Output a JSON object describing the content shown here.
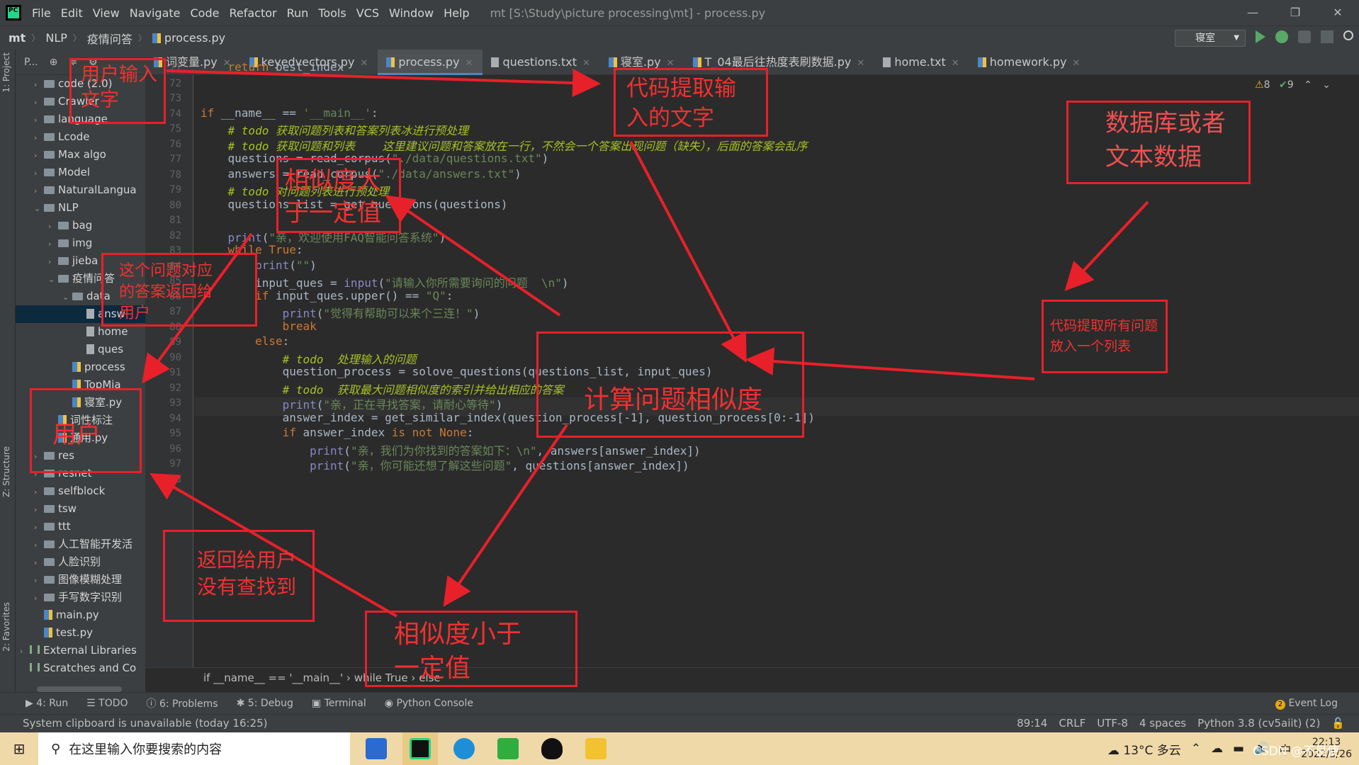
{
  "menubar": {
    "items": [
      "File",
      "Edit",
      "View",
      "Navigate",
      "Code",
      "Refactor",
      "Run",
      "Tools",
      "VCS",
      "Window",
      "Help"
    ],
    "window_title": "mt [S:\\Study\\picture processing\\mt] - process.py"
  },
  "navbar": {
    "crumbs": [
      "mt",
      "NLP",
      "疫情问答",
      "process.py"
    ],
    "run_config": "寝室"
  },
  "side_tabs": {
    "project": "1: Project",
    "structure": "Z: Structure",
    "favorites": "2: Favorites"
  },
  "project": {
    "header": "P...",
    "tree": [
      {
        "label": "code  (2.0)",
        "type": "folder",
        "depth": 1,
        "arrow": "›"
      },
      {
        "label": "Crawler",
        "type": "folder",
        "depth": 1,
        "arrow": "›"
      },
      {
        "label": "language",
        "type": "folder",
        "depth": 1,
        "arrow": "›"
      },
      {
        "label": "Lcode",
        "type": "folder",
        "depth": 1,
        "arrow": "›"
      },
      {
        "label": "Max algo",
        "type": "folder",
        "depth": 1,
        "arrow": "›"
      },
      {
        "label": "Model",
        "type": "folder",
        "depth": 1,
        "arrow": "›"
      },
      {
        "label": "NaturalLangua",
        "type": "folder",
        "depth": 1,
        "arrow": "›"
      },
      {
        "label": "NLP",
        "type": "folder",
        "depth": 1,
        "arrow": "⌄"
      },
      {
        "label": "bag",
        "type": "folder",
        "depth": 2,
        "arrow": "›"
      },
      {
        "label": "img",
        "type": "folder",
        "depth": 2,
        "arrow": "›"
      },
      {
        "label": "jieba",
        "type": "folder",
        "depth": 2,
        "arrow": "›"
      },
      {
        "label": "疫情问答",
        "type": "folder",
        "depth": 2,
        "arrow": "⌄"
      },
      {
        "label": "data",
        "type": "folder",
        "depth": 3,
        "arrow": "⌄"
      },
      {
        "label": "answ",
        "type": "txt",
        "depth": 4,
        "arrow": "",
        "selected": true
      },
      {
        "label": "home",
        "type": "txt",
        "depth": 4,
        "arrow": ""
      },
      {
        "label": "ques",
        "type": "txt",
        "depth": 4,
        "arrow": ""
      },
      {
        "label": "process",
        "type": "py",
        "depth": 3,
        "arrow": ""
      },
      {
        "label": "TopMia",
        "type": "py",
        "depth": 3,
        "arrow": ""
      },
      {
        "label": "寝室.py",
        "type": "py",
        "depth": 3,
        "arrow": ""
      },
      {
        "label": "词性标注",
        "type": "py",
        "depth": 2,
        "arrow": ""
      },
      {
        "label": "通用.py",
        "type": "py",
        "depth": 2,
        "arrow": ""
      },
      {
        "label": "res",
        "type": "folder",
        "depth": 1,
        "arrow": "›"
      },
      {
        "label": "resnet",
        "type": "folder",
        "depth": 1,
        "arrow": "›"
      },
      {
        "label": "selfblock",
        "type": "folder",
        "depth": 1,
        "arrow": "›"
      },
      {
        "label": "tsw",
        "type": "folder",
        "depth": 1,
        "arrow": "›"
      },
      {
        "label": "ttt",
        "type": "folder",
        "depth": 1,
        "arrow": "›"
      },
      {
        "label": "人工智能开发活",
        "type": "folder",
        "depth": 1,
        "arrow": "›"
      },
      {
        "label": "人脸识别",
        "type": "folder",
        "depth": 1,
        "arrow": "›"
      },
      {
        "label": "图像模糊处理",
        "type": "folder",
        "depth": 1,
        "arrow": "›"
      },
      {
        "label": "手写数字识别",
        "type": "folder",
        "depth": 1,
        "arrow": "›"
      },
      {
        "label": "main.py",
        "type": "py",
        "depth": 1,
        "arrow": ""
      },
      {
        "label": "test.py",
        "type": "py",
        "depth": 1,
        "arrow": ""
      },
      {
        "label": "External Libraries",
        "type": "lib",
        "depth": 0,
        "arrow": "›"
      },
      {
        "label": "Scratches and Co",
        "type": "lib",
        "depth": 0,
        "arrow": ""
      }
    ]
  },
  "tabs": [
    {
      "label": "词变量.py",
      "active": false
    },
    {
      "label": "keyedvectors.py",
      "active": false
    },
    {
      "label": "process.py",
      "active": true
    },
    {
      "label": "questions.txt",
      "active": false
    },
    {
      "label": "寝室.py",
      "active": false
    },
    {
      "label": "T_04最后往热度表刷数据.py",
      "active": false
    },
    {
      "label": "home.txt",
      "active": false
    },
    {
      "label": "homework.py",
      "active": false
    }
  ],
  "inspections": {
    "warnings": "8",
    "ok": "9"
  },
  "code": [
    {
      "n": "71",
      "html": "    <span class='kw'>return</span> best_index"
    },
    {
      "n": "72",
      "html": ""
    },
    {
      "n": "73",
      "html": ""
    },
    {
      "n": "74",
      "html": "<span class='kw'>if</span> __name__ == <span class='st'>'__main__'</span>:"
    },
    {
      "n": "75",
      "html": "    <span class='td'># todo 获取问题列表和答案列表冰进行预处理</span>"
    },
    {
      "n": "76",
      "html": "    <span class='td'># todo 获取问题和列表    这里建议问题和答案放在一行，不然会一个答案出现问题（缺失），后面的答案会乱序</span>"
    },
    {
      "n": "77",
      "html": "    questions = read_corpus(<span class='st'>\"./data/questions.txt\"</span>)"
    },
    {
      "n": "78",
      "html": "    answers = read_corpus(<span class='st'>\"./data/answers.txt\"</span>)"
    },
    {
      "n": "79",
      "html": "    <span class='td'># todo 对问题列表进行预处理</span>"
    },
    {
      "n": "80",
      "html": "    questions_list = get_questions(questions)"
    },
    {
      "n": "81",
      "html": ""
    },
    {
      "n": "82",
      "html": "    <span class='bi'>print</span>(<span class='st'>\"亲，欢迎使用FAQ智能问答系统\"</span>)"
    },
    {
      "n": "83",
      "html": "    <span class='kw'>while True</span>:"
    },
    {
      "n": "84",
      "html": "        <span class='bi'>print</span>(<span class='st'>\"\"</span>)"
    },
    {
      "n": "85",
      "html": "        input_ques = <span class='bi'>input</span>(<span class='st'>\"请输入你所需要询问的问题  \\n\"</span>)"
    },
    {
      "n": "86",
      "html": "        <span class='kw'>if</span> input_ques.upper() == <span class='st'>\"Q\"</span>:"
    },
    {
      "n": "87",
      "html": "            <span class='bi'>print</span>(<span class='st'>\"觉得有帮助可以来个三连！\"</span>)"
    },
    {
      "n": "88",
      "html": "            <span class='kw'>break</span>"
    },
    {
      "n": "89",
      "html": "        <span class='kw'>else</span>:"
    },
    {
      "n": "90",
      "html": "            <span class='td'># todo  处理输入的问题</span>"
    },
    {
      "n": "91",
      "html": "            question_process = solove_questions(questions_list, input_ques)"
    },
    {
      "n": "92",
      "html": "            <span class='td'># todo  获取最大问题相似度的索引并给出相应的答案</span>"
    },
    {
      "n": "93",
      "html": "            <span class='bi'>print</span>(<span class='st'>\"亲，正在寻找答案，请耐心等待\"</span>)"
    },
    {
      "n": "94",
      "html": "            answer_index = get_similar_index(question_process[-1], question_process[0:-1])"
    },
    {
      "n": "95",
      "html": "            <span class='kw'>if</span> answer_index <span class='kw'>is not None</span>:"
    },
    {
      "n": "96",
      "html": "                <span class='bi'>print</span>(<span class='st'>\"亲，我们为你找到的答案如下：\\n\"</span>, answers[answer_index])"
    },
    {
      "n": "97",
      "html": "                <span class='bi'>print</span>(<span class='st'>\"亲，你可能还想了解这些问题\"</span>, questions[answer_index])"
    },
    {
      "n": "98",
      "html": ""
    }
  ],
  "editor_breadcrumb": "if __name__ == '__main__'  ›  while True  ›  else",
  "bottom_tools": [
    "4: Run",
    "TODO",
    "6: Problems",
    "5: Debug",
    "Terminal",
    "Python Console"
  ],
  "event_log": "Event Log",
  "status": {
    "message": "System clipboard is unavailable (today 16:25)",
    "position": "89:14",
    "line_sep": "CRLF",
    "encoding": "UTF-8",
    "indent": "4 spaces",
    "interpreter": "Python 3.8 (cv5aiit) (2)"
  },
  "taskbar": {
    "search_placeholder": "在这里输入你要搜索的内容",
    "weather": "13°C 多云",
    "ime": "中",
    "time": "22:13",
    "date": "2022/3/26"
  },
  "annotations": {
    "user_input": "用户输入文字",
    "code_extract": "代码提取输入的文字",
    "database": "数据库或者文本数据",
    "similarity_high": "相似度大于一定值",
    "answer_return": "这个问题对应的答案返回给用户",
    "user": "用户",
    "extract_all": "代码提取所有问题放入一个列表",
    "compute": "计算问题相似度",
    "not_found": "返回给用户没有查找到",
    "similarity_low": "相似度小于一定值"
  },
  "watermark": "CSDN @不良使"
}
